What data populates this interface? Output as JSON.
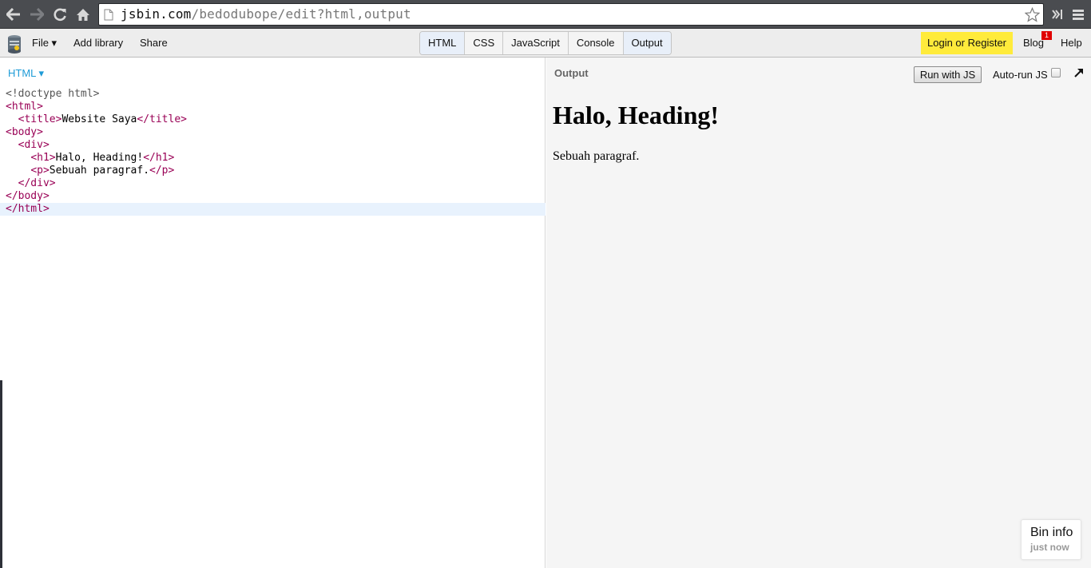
{
  "browser": {
    "url_host": "jsbin.com",
    "url_path": "/bedodubope/edit?html,output",
    "icons": [
      "back-icon",
      "forward-icon",
      "reload-icon",
      "home-icon",
      "page-icon",
      "bookmark-star-icon",
      "extensions-icon",
      "menu-icon"
    ]
  },
  "toolbar": {
    "file_label": "File ▾",
    "add_library_label": "Add library",
    "share_label": "Share",
    "panels": [
      {
        "label": "HTML",
        "active": true
      },
      {
        "label": "CSS",
        "active": false
      },
      {
        "label": "JavaScript",
        "active": false
      },
      {
        "label": "Console",
        "active": false
      },
      {
        "label": "Output",
        "active": true
      }
    ],
    "login_label": "Login or Register",
    "blog_label": "Blog",
    "blog_badge": "1",
    "help_label": "Help",
    "colors": {
      "login_bg": "#ffeb3b",
      "badge_bg": "#e00000",
      "active_tab_bg": "#e8eff9"
    }
  },
  "editor": {
    "panel_label": "HTML ▾",
    "code_lines": [
      "<!doctype html>",
      "<html>",
      "  <title>Website Saya</title>",
      "<body>",
      "  <div>",
      "    <h1>Halo, Heading!</h1>",
      "    <p>Sebuah paragraf.</p>",
      "  </div>",
      "</body>",
      "</html>"
    ],
    "active_line": 9
  },
  "output": {
    "panel_label": "Output",
    "run_button_label": "Run with JS",
    "autorun_label": "Auto-run JS",
    "autorun_checked": false,
    "heading": "Halo, Heading!",
    "paragraph": "Sebuah paragraf."
  },
  "bin_info": {
    "title": "Bin info",
    "time": "just now"
  }
}
